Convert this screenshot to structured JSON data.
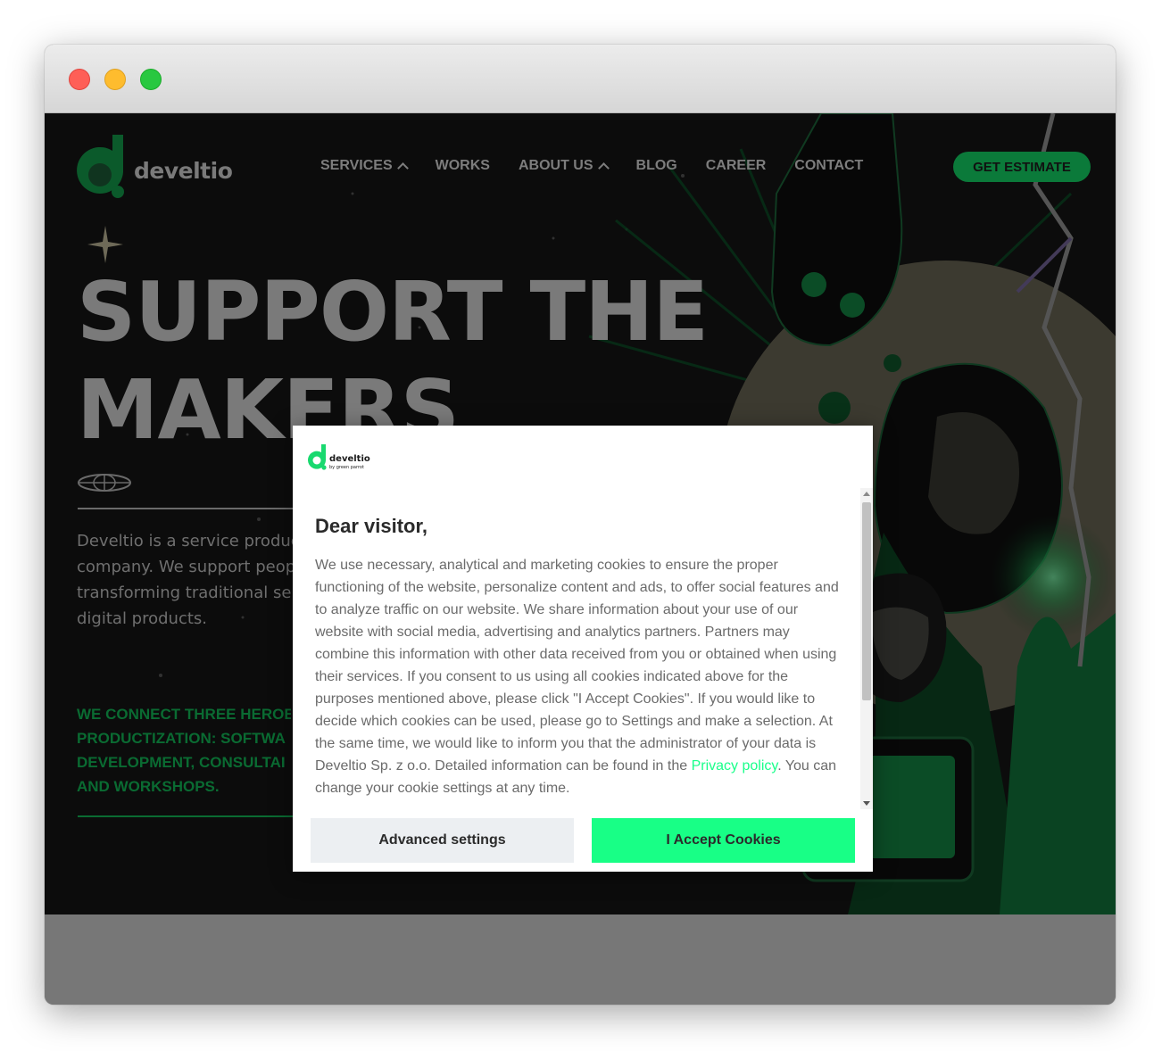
{
  "window": {
    "controls": [
      "close",
      "minimize",
      "maximize"
    ]
  },
  "brand": {
    "name": "develtio",
    "modal_name": "develtio",
    "modal_tagline": "by green parrot",
    "green": "#0b7a3a",
    "accent": "#18ff86"
  },
  "nav": {
    "items": [
      {
        "label": "SERVICES",
        "dropdown": true
      },
      {
        "label": "WORKS",
        "dropdown": false
      },
      {
        "label": "ABOUT US",
        "dropdown": true
      },
      {
        "label": "BLOG",
        "dropdown": false
      },
      {
        "label": "CAREER",
        "dropdown": false
      },
      {
        "label": "CONTACT",
        "dropdown": false
      }
    ],
    "cta": "GET ESTIMATE"
  },
  "hero": {
    "title_line1": "SUPPORT THE",
    "title_line2": "MAKERS",
    "description_lines": [
      "Develtio is a service produc",
      "company. We support peop",
      "transforming traditional ser",
      "digital products."
    ],
    "heroes_lines": [
      "WE CONNECT THREE HEROE",
      "PRODUCTIZATION: SOFTWA",
      "DEVELOPMENT, CONSULTAI",
      "AND WORKSHOPS."
    ]
  },
  "cookie_modal": {
    "heading": "Dear visitor,",
    "body_before_link": "We use necessary, analytical and marketing cookies to ensure the proper functioning of the website, personalize content and ads, to offer social features and to analyze traffic on our website. We share information about your use of our website with social media, advertising and analytics partners. Partners may combine this information with other data received from you or obtained when using their services. If you consent to us using all cookies indicated above for the purposes mentioned above, please click \"I Accept Cookies\". If you would like to decide which cookies can be used, please go to Settings and make a selection. At the same time, we would like to inform you that the administrator of your data is Develtio Sp. z o.o. Detailed information can be found in the ",
    "link_text": "Privacy policy",
    "body_after_link": ". You can change your cookie settings at any time.",
    "advanced_label": "Advanced settings",
    "accept_label": "I Accept Cookies"
  }
}
